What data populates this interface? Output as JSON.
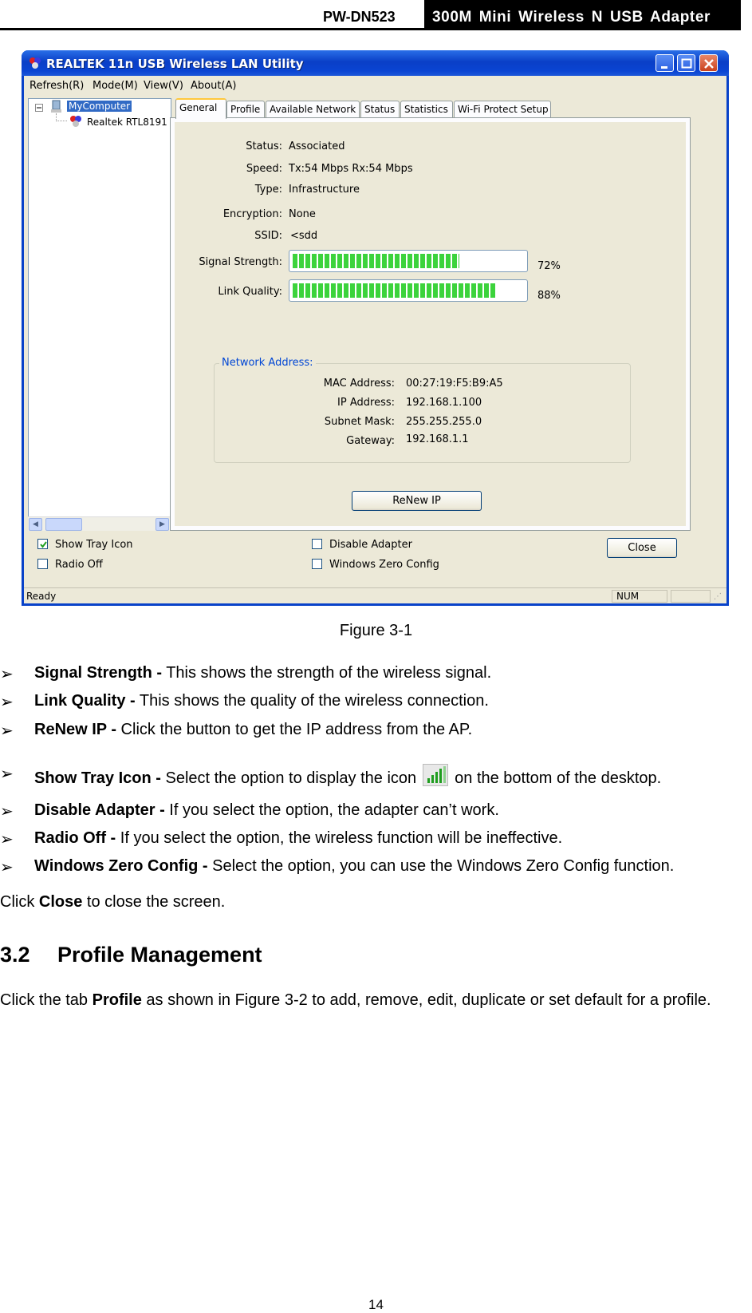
{
  "header": {
    "model": "PW-DN523",
    "product": "300M Mini Wireless N USB Adapter"
  },
  "window": {
    "title": "REALTEK 11n USB Wireless LAN Utility",
    "menu": [
      "Refresh(R)",
      "Mode(M)",
      "View(V)",
      "About(A)"
    ],
    "tree": {
      "root": "MyComputer",
      "child": "Realtek RTL8191"
    },
    "tabs": [
      "General",
      "Profile",
      "Available Network",
      "Status",
      "Statistics",
      "Wi-Fi Protect Setup"
    ],
    "general": {
      "status_label": "Status:",
      "status_value": "Associated",
      "speed_label": "Speed:",
      "speed_value": "Tx:54 Mbps Rx:54 Mbps",
      "type_label": "Type:",
      "type_value": "Infrastructure",
      "encryption_label": "Encryption:",
      "encryption_value": "None",
      "ssid_label": "SSID:",
      "ssid_value": "<sdd",
      "signal_label": "Signal Strength:",
      "signal_percent": 72,
      "signal_text": "72%",
      "link_label": "Link Quality:",
      "link_percent": 88,
      "link_text": "88%"
    },
    "network_address": {
      "title": "Network Address:",
      "mac_label": "MAC Address:",
      "mac_value": "00:27:19:F5:B9:A5",
      "ip_label": "IP Address:",
      "ip_value": "192.168.1.100",
      "subnet_label": "Subnet Mask:",
      "subnet_value": "255.255.255.0",
      "gateway_label": "Gateway:",
      "gateway_value": "192.168.1.1"
    },
    "renew_button": "ReNew IP",
    "options": {
      "show_tray_icon": {
        "label": "Show Tray Icon",
        "checked": true
      },
      "radio_off": {
        "label": "Radio Off",
        "checked": false
      },
      "disable_adapter": {
        "label": "Disable Adapter",
        "checked": false
      },
      "windows_zero_config": {
        "label": "Windows Zero Config",
        "checked": false
      }
    },
    "close_button": "Close",
    "statusbar": {
      "ready": "Ready",
      "num": "NUM"
    }
  },
  "caption": "Figure 3-1",
  "bullets": [
    {
      "term": "Signal Strength -",
      "desc": " This shows the strength of the wireless signal."
    },
    {
      "term": "Link Quality -",
      "desc": " This shows the quality of the wireless connection."
    },
    {
      "term": "ReNew IP -",
      "desc": " Click the button to get the IP address from the AP."
    },
    {
      "term": "Show Tray Icon -",
      "desc": " Select the option to display the icon",
      "desc_after": "on the bottom of the desktop."
    },
    {
      "term": "Disable Adapter -",
      "desc": " If you select the option, the adapter can’t work."
    },
    {
      "term": "Radio Off -",
      "desc": " If you select the option, the wireless function will be ineffective."
    },
    {
      "term": "Windows Zero Config -",
      "desc": " Select the option, you can use the Windows Zero Config function."
    }
  ],
  "close_note": {
    "pre": "Click ",
    "bold": "Close",
    "post": " to close the screen."
  },
  "section": {
    "number": "3.2",
    "title": "Profile Management",
    "intro_pre": "Click the tab ",
    "intro_bold": "Profile",
    "intro_post": " as shown in Figure 3-2 to add, remove, edit, duplicate or set default for a profile."
  },
  "bullet_marker": "➢",
  "page_number": "14",
  "colors": {
    "title_bar": "#0a3fc7",
    "signal_green": "#3cd33c",
    "group_title": "#0046d5"
  }
}
